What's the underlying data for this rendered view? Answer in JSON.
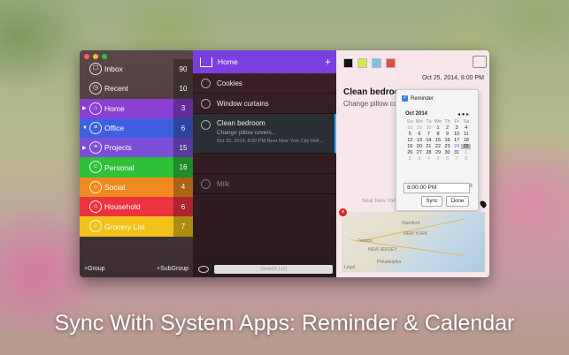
{
  "sidebar": {
    "items": [
      {
        "label": "Inbox",
        "count": "90",
        "color": "transparent",
        "icon": "inbox-icon",
        "glyph": "☐",
        "tri": ""
      },
      {
        "label": "Recent",
        "count": "10",
        "color": "transparent",
        "icon": "clock-icon",
        "glyph": "◷",
        "tri": ""
      },
      {
        "label": "Home",
        "count": "3",
        "color": "#8a3fd1",
        "icon": "home-icon",
        "glyph": "⌂",
        "tri": "▶"
      },
      {
        "label": "Office",
        "count": "6",
        "color": "#3f5fe0",
        "icon": "list-icon",
        "glyph": "≡",
        "tri": "▼"
      },
      {
        "label": "Projects",
        "count": "15",
        "color": "#7a4fd8",
        "icon": "list-icon",
        "glyph": "≡",
        "tri": "▶"
      },
      {
        "label": "Personal",
        "count": "16",
        "color": "#2fc03a",
        "icon": "person-icon",
        "glyph": "☺",
        "tri": ""
      },
      {
        "label": "Social",
        "count": "4",
        "color": "#f08a1e",
        "icon": "home-icon",
        "glyph": "⌂",
        "tri": ""
      },
      {
        "label": "Household",
        "count": "6",
        "color": "#ee3340",
        "icon": "home-icon",
        "glyph": "⌂",
        "tri": ""
      },
      {
        "label": "Grocery List",
        "count": "7",
        "color": "#f2c21a",
        "icon": "home-icon",
        "glyph": "⌂",
        "tri": ""
      }
    ],
    "add_group": "+Group",
    "add_subgroup": "+SubGroup"
  },
  "list": {
    "title": "Home",
    "add": "+",
    "tasks": [
      {
        "title": "Cookies"
      },
      {
        "title": "Window curtains"
      },
      {
        "title": "Clean bedroom",
        "note": "Change pillow covers...",
        "meta": "Oct 25, 2014, 8:00 PM Near New York City Hell..."
      },
      {
        "title": ""
      },
      {
        "title": "Milk"
      }
    ],
    "search_placeholder": "Search List"
  },
  "detail": {
    "colors": [
      "#111111",
      "#d8e84a",
      "#7ec0e8",
      "#e64a4a"
    ],
    "date": "Oct 25, 2014, 8:00 PM",
    "title": "Clean bedroom",
    "note": "Change pillow covers...",
    "near": "Near New York",
    "reminder_label": "Reminder",
    "month": "Oct 2014",
    "month_nav": "◂ ● ▸",
    "weekdays": [
      "Su",
      "Mo",
      "Tu",
      "We",
      "Th",
      "Fr",
      "Sa"
    ],
    "days": [
      "28",
      "29",
      "30",
      "1",
      "2",
      "3",
      "4",
      "5",
      "6",
      "7",
      "8",
      "9",
      "10",
      "11",
      "12",
      "13",
      "14",
      "15",
      "16",
      "17",
      "18",
      "19",
      "20",
      "21",
      "22",
      "23",
      "24",
      "25",
      "26",
      "27",
      "28",
      "29",
      "30",
      "31",
      "1",
      "2",
      "3",
      "4",
      "5",
      "6",
      "7",
      "8"
    ],
    "time": "8:00:00 PM",
    "sync": "Sync",
    "done": "Done",
    "map_labels": [
      "Stamford",
      "NEW YORK",
      "NEW JERSEY",
      "Philadelphia",
      "Trenton",
      "Legal"
    ]
  },
  "caption": "Sync With System Apps: Reminder & Calendar"
}
